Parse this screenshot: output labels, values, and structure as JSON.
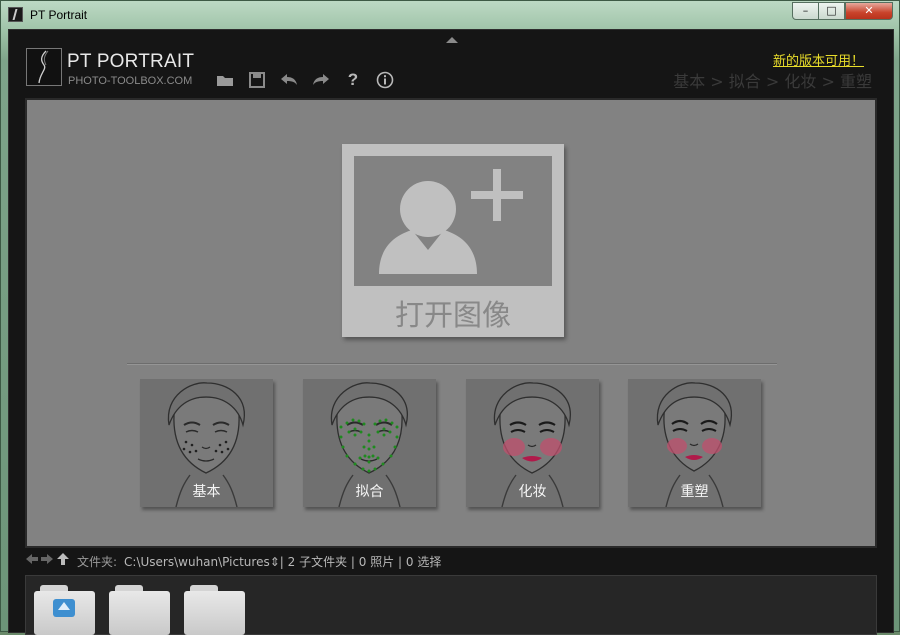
{
  "window": {
    "title": "PT Portrait",
    "controls": {
      "minimize": "–",
      "maximize": "□",
      "close": "✕"
    }
  },
  "header": {
    "brand_name": "PT PORTRAIT",
    "brand_url": "PHOTO-TOOLBOX.COM",
    "update_link": "新的版本可用！",
    "toolbar_icons": [
      "open-folder-icon",
      "save-icon",
      "undo-icon",
      "redo-icon",
      "help-icon",
      "info-icon"
    ],
    "help_glyph": "?",
    "breadcrumb": [
      "基本",
      "拟合",
      "化妆",
      "重塑"
    ],
    "breadcrumb_separator": " > "
  },
  "main": {
    "open_image_label": "打开图像",
    "modes": [
      {
        "label": "基本",
        "icon": "face-basic-icon"
      },
      {
        "label": "拟合",
        "icon": "face-fitting-icon"
      },
      {
        "label": "化妆",
        "icon": "face-makeup-icon"
      },
      {
        "label": "重塑",
        "icon": "face-reshape-icon"
      }
    ]
  },
  "pathbar": {
    "label": "文件夹:",
    "path": "C:\\Users\\wuhan\\Pictures",
    "stats": "| 2 子文件夹 | 0 照片 | 0 选择"
  },
  "colors": {
    "accent_link": "#e8dc2a",
    "fit_points": "#1f8a1f",
    "blush": "#c0506e",
    "lips": "#b01a4a"
  }
}
